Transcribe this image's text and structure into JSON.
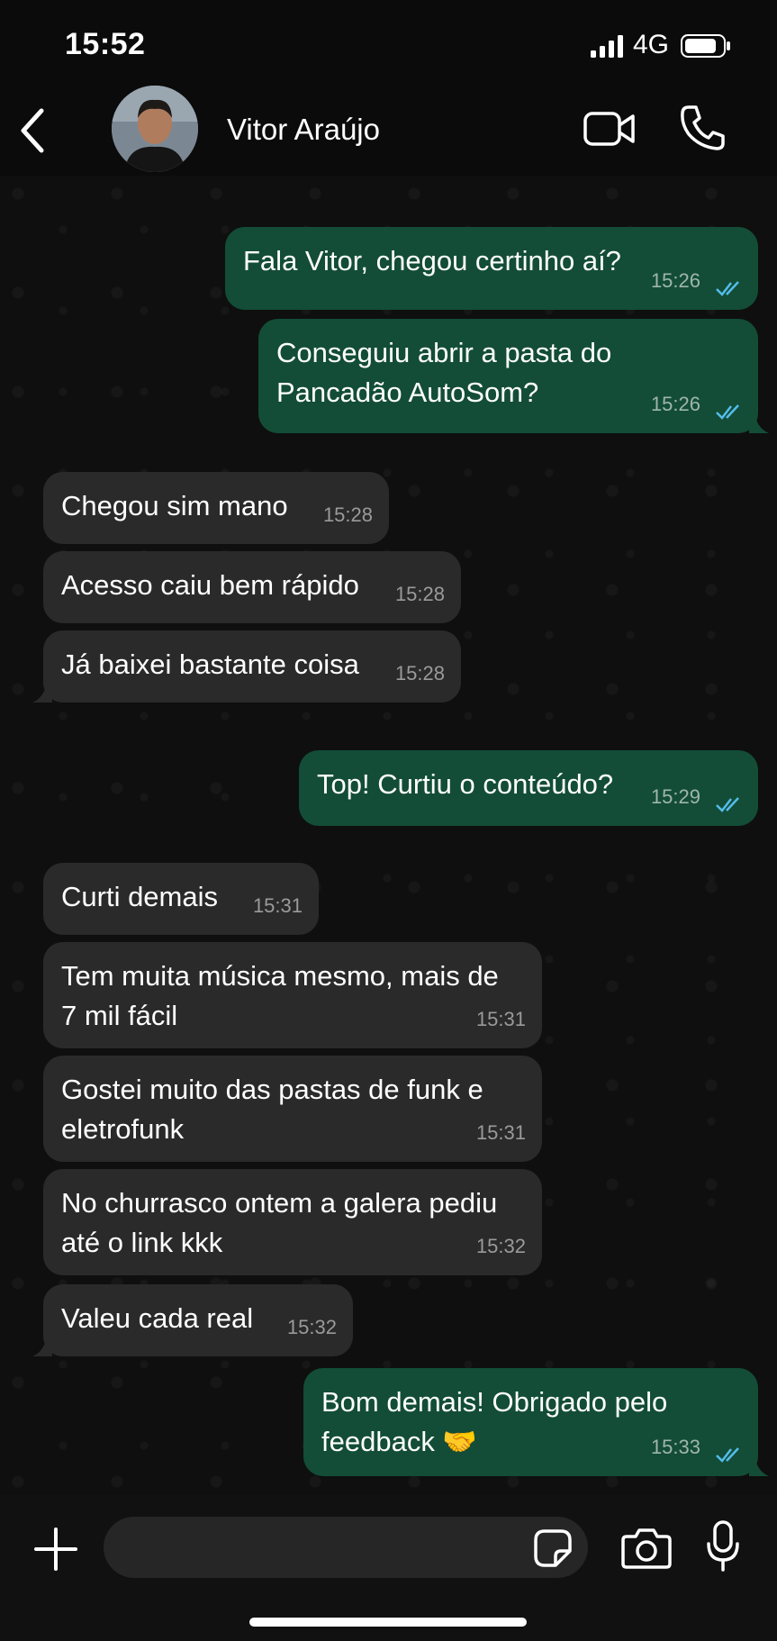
{
  "status_bar": {
    "time": "15:52",
    "network": "4G"
  },
  "header": {
    "contact_name": "Vitor Araújo"
  },
  "messages": [
    {
      "text": "Fala Vitor, chegou certinho aí?",
      "time": "15:26",
      "dir": "out"
    },
    {
      "text": "Conseguiu abrir a pasta do\nPancadão AutoSom?",
      "time": "15:26",
      "dir": "out"
    },
    {
      "text": "Chegou sim mano",
      "time": "15:28",
      "dir": "in"
    },
    {
      "text": "Acesso caiu bem rápido",
      "time": "15:28",
      "dir": "in"
    },
    {
      "text": "Já baixei bastante coisa",
      "time": "15:28",
      "dir": "in"
    },
    {
      "text": "Top! Curtiu o conteúdo?",
      "time": "15:29",
      "dir": "out"
    },
    {
      "text": "Curti demais",
      "time": "15:31",
      "dir": "in"
    },
    {
      "text": "Tem muita música mesmo, mais de\n7 mil fácil",
      "time": "15:31",
      "dir": "in"
    },
    {
      "text": "Gostei muito das pastas de funk e\neletrofunk",
      "time": "15:31",
      "dir": "in"
    },
    {
      "text": "No churrasco ontem a galera pediu\naté o link kkk",
      "time": "15:32",
      "dir": "in"
    },
    {
      "text": "Valeu cada real",
      "time": "15:32",
      "dir": "in"
    },
    {
      "text": "Bom demais! Obrigado pelo\nfeedback 🤝",
      "time": "15:33",
      "dir": "out"
    }
  ],
  "composer": {
    "value": "",
    "placeholder": ""
  },
  "colors": {
    "outgoing": "#134d37",
    "incoming": "#2a2a2a",
    "read_ticks": "#53bdeb"
  }
}
